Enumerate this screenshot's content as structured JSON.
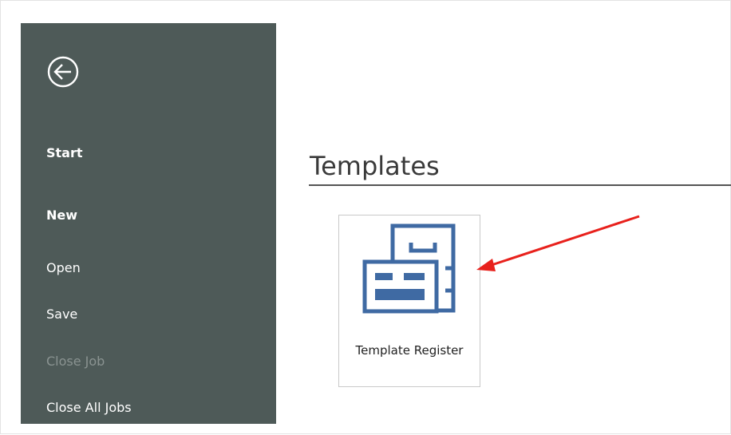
{
  "sidebar": {
    "back_icon": "back-arrow-circle-icon",
    "items": [
      {
        "label": "Start",
        "bold": true,
        "enabled": true
      },
      {
        "label": "New",
        "bold": true,
        "enabled": true
      },
      {
        "label": "Open",
        "bold": false,
        "enabled": true
      },
      {
        "label": "Save",
        "bold": false,
        "enabled": true
      },
      {
        "label": "Close Job",
        "bold": false,
        "enabled": false
      },
      {
        "label": "Close All Jobs",
        "bold": false,
        "enabled": true
      }
    ]
  },
  "main": {
    "heading": "Templates",
    "templates": [
      {
        "label": "Template Register",
        "icon": "template-register-icon"
      }
    ]
  },
  "annotation": {
    "type": "arrow",
    "color": "#e8211c",
    "points_to": "template-register-tile"
  },
  "colors": {
    "sidebar_bg": "#4e5a58",
    "icon_blue": "#3f6aa3",
    "disabled_text": "#8a9391"
  }
}
